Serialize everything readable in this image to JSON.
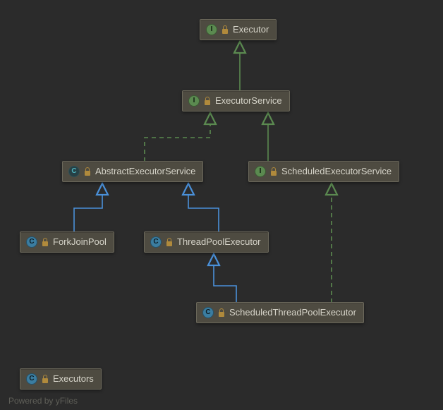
{
  "nodes": {
    "executor": {
      "kind": "I",
      "label": "Executor"
    },
    "executorService": {
      "kind": "I",
      "label": "ExecutorService"
    },
    "abstractExecSvc": {
      "kind": "Cc",
      "label": "AbstractExecutorService"
    },
    "scheduledExecSvc": {
      "kind": "I",
      "label": "ScheduledExecutorService"
    },
    "forkJoinPool": {
      "kind": "C",
      "label": "ForkJoinPool"
    },
    "threadPoolExecutor": {
      "kind": "C",
      "label": "ThreadPoolExecutor"
    },
    "scheduledTPE": {
      "kind": "C",
      "label": "ScheduledThreadPoolExecutor"
    },
    "executors": {
      "kind": "C",
      "label": "Executors"
    }
  },
  "footer": "Powered by yFiles",
  "colors": {
    "green": "#5b8a50",
    "blue": "#4a90d9"
  }
}
